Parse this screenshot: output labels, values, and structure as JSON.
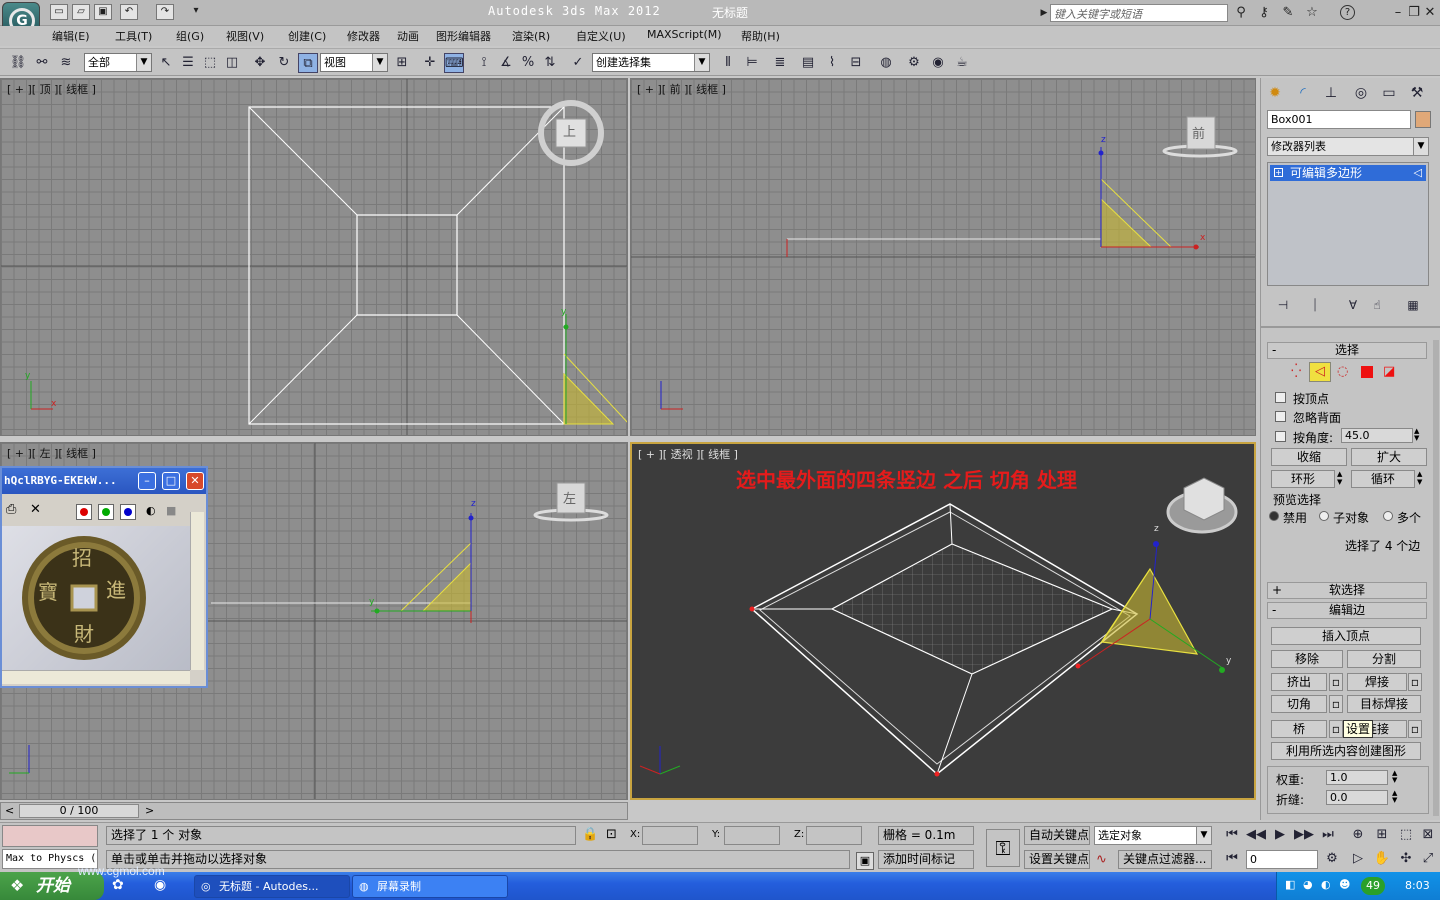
{
  "app": {
    "logo_glyph": "G",
    "title": "Autodesk 3ds Max  2012",
    "document": "无标题",
    "search_placeholder": "键入关键字或短语"
  },
  "menu": [
    "编辑(E)",
    "工具(T)",
    "组(G)",
    "视图(V)",
    "创建(C)",
    "修改器",
    "动画",
    "图形编辑器",
    "渲染(R)",
    "自定义(U)",
    "MAXScript(M)",
    "帮助(H)"
  ],
  "toolbar": {
    "filter_select": "全部",
    "coord_select": "视图",
    "selection_set": "创建选择集"
  },
  "viewports": {
    "top": "[ + ][ 顶 ][ 线框 ]",
    "front": "[ + ][ 前 ][ 线框 ]",
    "left": "[ + ][ 左 ][ 线框 ]",
    "persp": "[ + ][ 透视 ][ 线框 ]",
    "annotation": "选中最外面的四条竖边 之后 切角 处理",
    "cube_top": "上",
    "cube_front": "前",
    "cube_left": "左",
    "axis_x": "x",
    "axis_y": "y",
    "axis_z": "z"
  },
  "panel": {
    "object_name": "Box001",
    "object_color": "#e0a878",
    "modifier_list": "修改器列表",
    "stack_item": "可编辑多边形",
    "selection": {
      "title": "选择",
      "by_vertex": "按顶点",
      "ignore_backface": "忽略背面",
      "by_angle": "按角度:",
      "angle_value": "45.0",
      "shrink": "收缩",
      "grow": "扩大",
      "ring": "环形",
      "loop": "循环",
      "preview": "预览选择",
      "disabled": "禁用",
      "subobject": "子对象",
      "multi": "多个",
      "status": "选择了 4 个边"
    },
    "soft_selection": "软选择",
    "edit_edges": {
      "title": "编辑边",
      "insert_vertex": "插入顶点",
      "remove": "移除",
      "split": "分割",
      "extrude": "挤出",
      "weld": "焊接",
      "chamfer": "切角",
      "target_weld": "目标焊接",
      "bridge": "桥",
      "connect": "连接",
      "tooltip": "设置",
      "create_shape": "利用所选内容创建图形",
      "weight_label": "权重:",
      "weight_value": "1.0",
      "crease_label": "折缝:",
      "crease_value": "0.0"
    }
  },
  "timeline": {
    "range": "0 / 100",
    "prev": "<",
    "next": ">"
  },
  "status": {
    "script_label": "Max to Physcs (",
    "selected": "选择了 1 个 对象",
    "hint": "单击或单击并拖动以选择对象",
    "x_label": "X:",
    "y_label": "Y:",
    "z_label": "Z:",
    "grid": "栅格 = 0.1m",
    "add_time_tag": "添加时间标记",
    "auto_key": "自动关键点",
    "set_key": "设置关键点",
    "key_target": "选定对象",
    "key_filters": "关键点过滤器...",
    "frame": "0"
  },
  "image_window": {
    "title": "hQclRBYG-EKEkW...",
    "coin_chars": [
      "招",
      "進",
      "財",
      "寶"
    ]
  },
  "taskbar": {
    "start": "开始",
    "tasks": [
      "无标题 - Autodes...",
      "屏幕录制"
    ],
    "clock": "8:03",
    "tray_badge": "49",
    "watermark": "www.cgmol.com"
  }
}
